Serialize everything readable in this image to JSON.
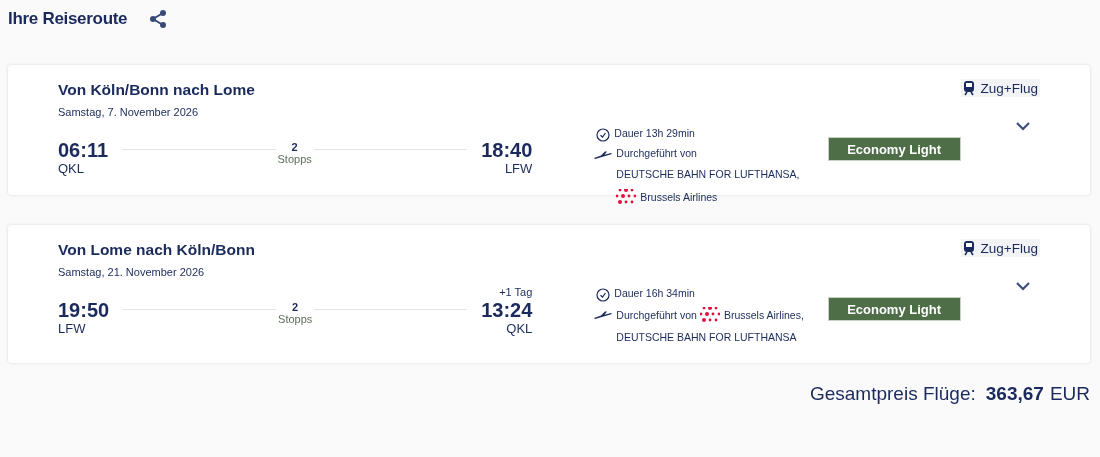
{
  "header": {
    "title": "Ihre Reiseroute"
  },
  "segments": [
    {
      "route": "Von Köln/Bonn nach Lome",
      "date": "Samstag, 7. November 2026",
      "badge": "Zug+Flug",
      "departure": {
        "time": "06:11",
        "airport": "QKL"
      },
      "stops": {
        "count": "2",
        "label": "Stopps"
      },
      "arrival": {
        "time": "18:40",
        "airport": "LFW"
      },
      "duration": "Dauer 13h 29min",
      "operated_label": "Durchgeführt von",
      "operators": [
        {
          "name": "DEUTSCHE BAHN FOR LUFTHANSA,",
          "logo": false
        },
        {
          "name": "Brussels Airlines",
          "logo": true
        }
      ],
      "fare": "Economy Light",
      "expanded": false
    },
    {
      "route": "Von Lome nach Köln/Bonn",
      "date": "Samstag, 21. November 2026",
      "badge": "Zug+Flug",
      "departure": {
        "time": "19:50",
        "airport": "LFW"
      },
      "stops": {
        "count": "2",
        "label": "Stopps"
      },
      "arrival": {
        "time": "13:24",
        "airport": "QKL",
        "day_offset": "+1 Tag"
      },
      "duration": "Dauer 16h 34min",
      "operated_label": "Durchgeführt von",
      "operators": [
        {
          "name": "Brussels Airlines,",
          "logo": true
        },
        {
          "name": "DEUTSCHE BAHN FOR LUFTHANSA",
          "logo": false
        }
      ],
      "fare": "Economy Light",
      "expanded": false
    }
  ],
  "total": {
    "label": "Gesamtpreis Flüge:",
    "amount": "363,67",
    "currency": "EUR"
  }
}
